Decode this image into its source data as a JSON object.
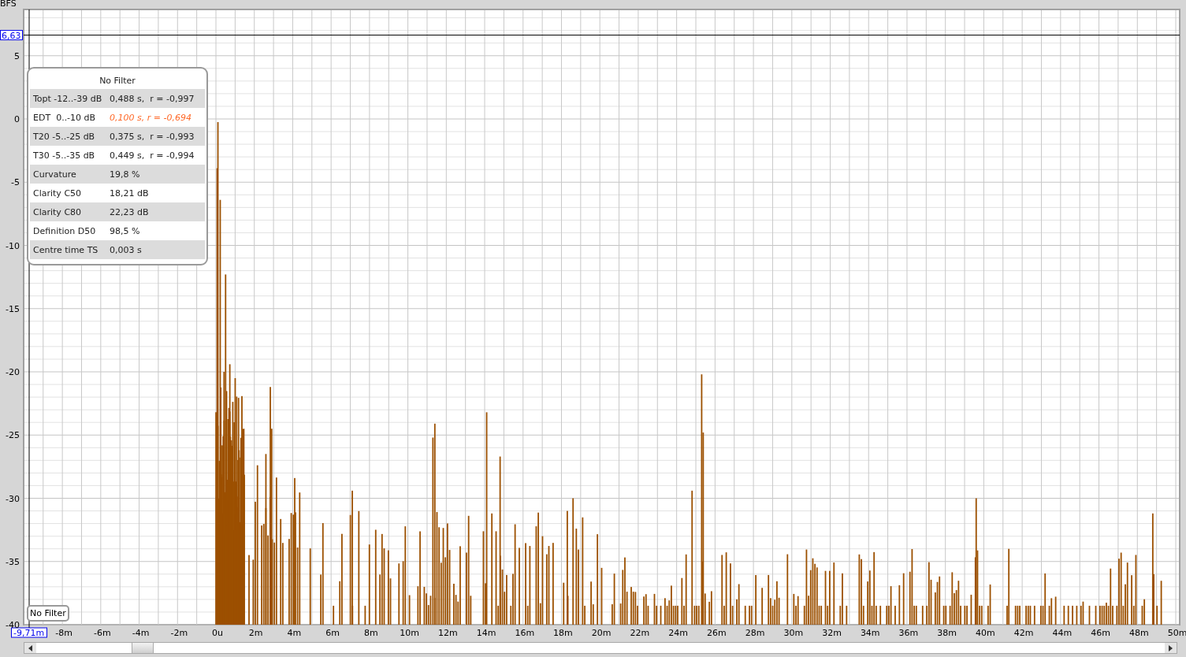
{
  "y_axis": {
    "unit": "BFS",
    "cursor": "6,63",
    "ticks": [
      "5",
      "0",
      "-5",
      "-10",
      "-15",
      "-20",
      "-25",
      "-30",
      "-35",
      "-40"
    ]
  },
  "x_axis": {
    "cursor": "-9,71m",
    "ticks": [
      "-8m",
      "-6m",
      "-4m",
      "-2m",
      "0u",
      "2m",
      "4m",
      "6m",
      "8m",
      "10m",
      "12m",
      "14m",
      "16m",
      "18m",
      "20m",
      "22m",
      "24m",
      "26m",
      "28m",
      "30m",
      "32m",
      "34m",
      "36m",
      "38m",
      "40m",
      "42m",
      "44m",
      "46m",
      "48m",
      "50m"
    ]
  },
  "info_panel": {
    "title": "No Filter",
    "rows": [
      {
        "label": "Topt -12..-39 dB",
        "value": "0,488 s,  r = -0,997",
        "warning": false
      },
      {
        "label": "EDT  0..-10 dB",
        "value": "0,100 s, r = -0,694",
        "warning": true
      },
      {
        "label": "T20 -5..-25 dB",
        "value": "0,375 s,  r = -0,993",
        "warning": false
      },
      {
        "label": "T30 -5..-35 dB",
        "value": "0,449 s,  r = -0,994",
        "warning": false
      },
      {
        "label": "Curvature",
        "value": "19,8 %",
        "warning": false
      },
      {
        "label": "Clarity C50",
        "value": "18,21 dB",
        "warning": false
      },
      {
        "label": "Clarity C80",
        "value": "22,23 dB",
        "warning": false
      },
      {
        "label": "Definition D50",
        "value": "98,5 %",
        "warning": false
      },
      {
        "label": "Centre time TS",
        "value": "0,003 s",
        "warning": false
      }
    ]
  },
  "legend": {
    "label": "No Filter"
  }
}
